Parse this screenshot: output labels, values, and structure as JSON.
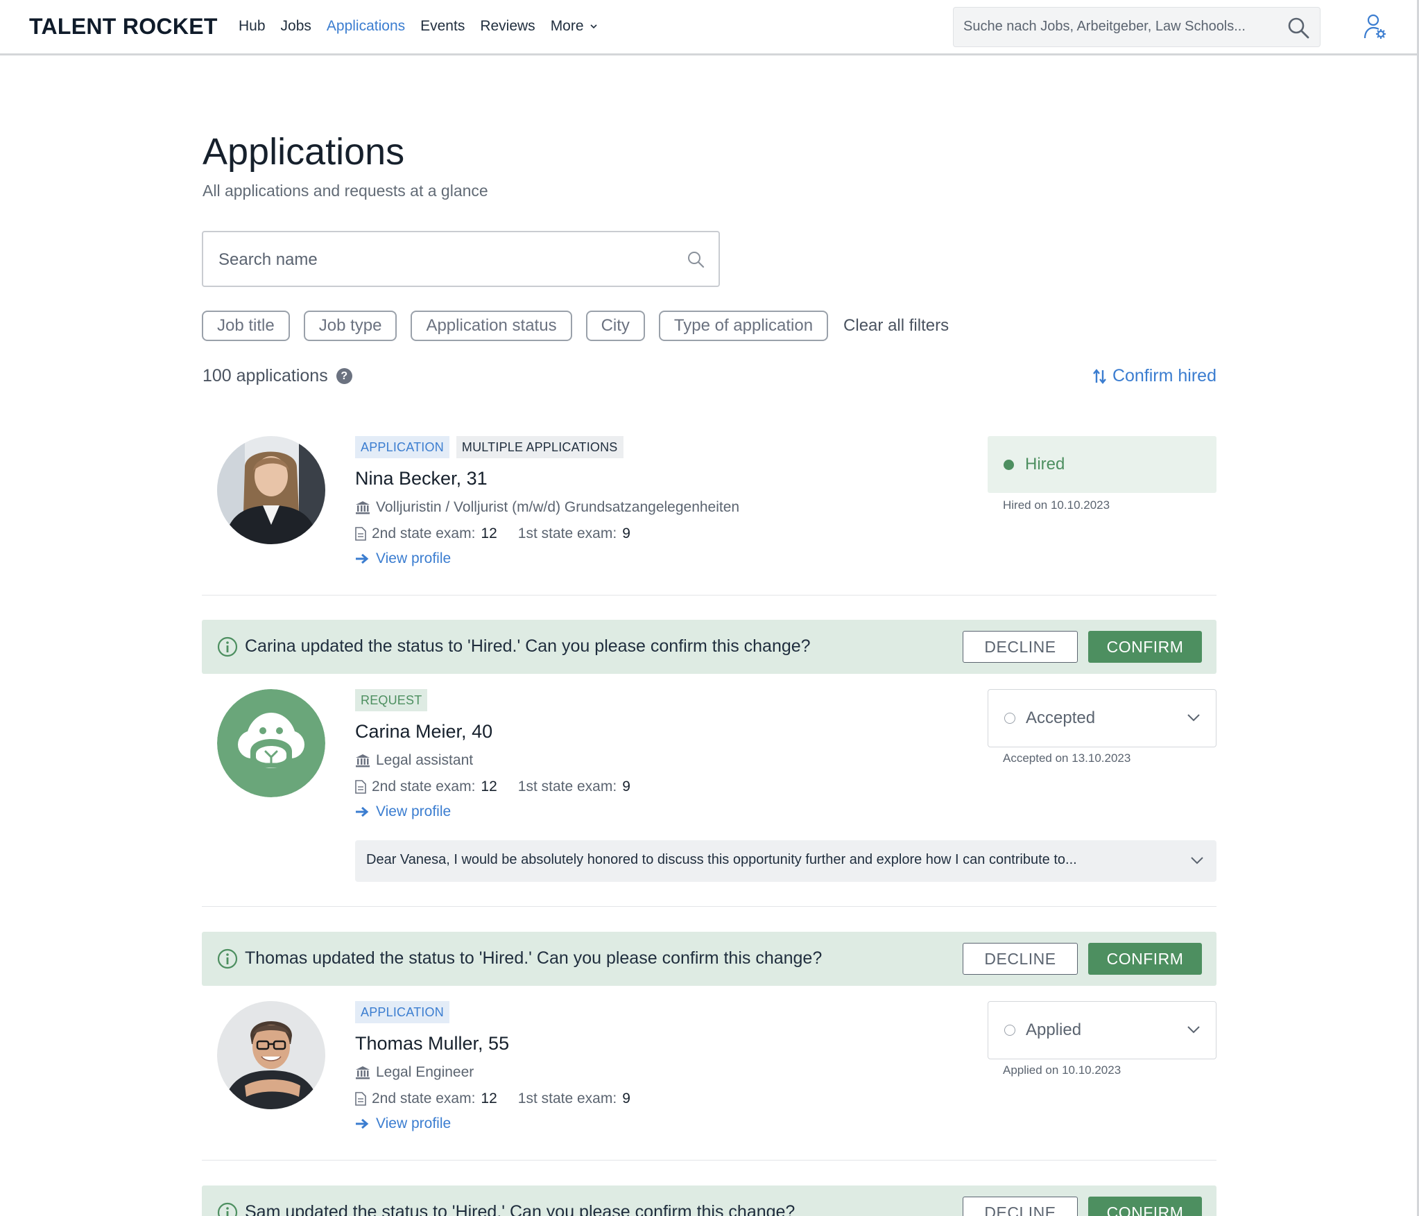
{
  "header": {
    "logo": "TALENT ROCKET",
    "nav": [
      {
        "label": "Hub"
      },
      {
        "label": "Jobs"
      },
      {
        "label": "Applications",
        "active": true
      },
      {
        "label": "Events"
      },
      {
        "label": "Reviews"
      },
      {
        "label": "More"
      }
    ],
    "search_placeholder": "Suche nach Jobs, Arbeitgeber, Law Schools...",
    "icons": [
      "search-icon",
      "user-settings-icon",
      "chevron-down-icon"
    ]
  },
  "page": {
    "title": "Applications",
    "subtitle": "All applications and requests at a glance",
    "search_placeholder": "Search name",
    "filters": [
      "Job title",
      "Job type",
      "Application status",
      "City",
      "Type of application"
    ],
    "clear_filters": "Clear all filters",
    "count": "100 applications",
    "help": "?",
    "sort_label": "Confirm hired"
  },
  "colors": {
    "accent_blue": "#3b7dd0",
    "green": "#4d8f60",
    "notice_bg": "#deebe3"
  },
  "notices": {
    "decline": "DECLINE",
    "confirm": "CONFIRM",
    "carina": "Carina updated the status to 'Hired.' Can you please confirm this change?",
    "thomas": "Thomas updated the status to 'Hired.' Can you please confirm this change?",
    "sam": "Sam updated the status to 'Hired.' Can you please confirm this change?"
  },
  "applications": [
    {
      "tags": [
        "APPLICATION",
        "MULTIPLE APPLICATIONS"
      ],
      "name": "Nina Becker, 31",
      "job": "Volljuristin / Volljurist (m/w/d) Grundsatzangelegenheiten",
      "exam2_label": "2nd state exam:",
      "exam2": "12",
      "exam1_label": "1st state exam:",
      "exam1": "9",
      "view_profile": "View profile",
      "status": "Hired",
      "status_date": "Hired on 10.10.2023"
    },
    {
      "tags": [
        "REQUEST"
      ],
      "name": "Carina Meier, 40",
      "job": "Legal assistant",
      "exam2_label": "2nd state exam:",
      "exam2": "12",
      "exam1_label": "1st state exam:",
      "exam1": "9",
      "view_profile": "View profile",
      "status": "Accepted",
      "status_date": "Accepted on 13.10.2023",
      "message": "Dear Vanesa, I would be absolutely honored to discuss this opportunity further and explore how I can contribute to..."
    },
    {
      "tags": [
        "APPLICATION"
      ],
      "name": "Thomas Muller, 55",
      "job": "Legal Engineer",
      "exam2_label": "2nd state exam:",
      "exam2": "12",
      "exam1_label": "1st state exam:",
      "exam1": "9",
      "view_profile": "View profile",
      "status": "Applied",
      "status_date": "Applied on 10.10.2023"
    }
  ]
}
